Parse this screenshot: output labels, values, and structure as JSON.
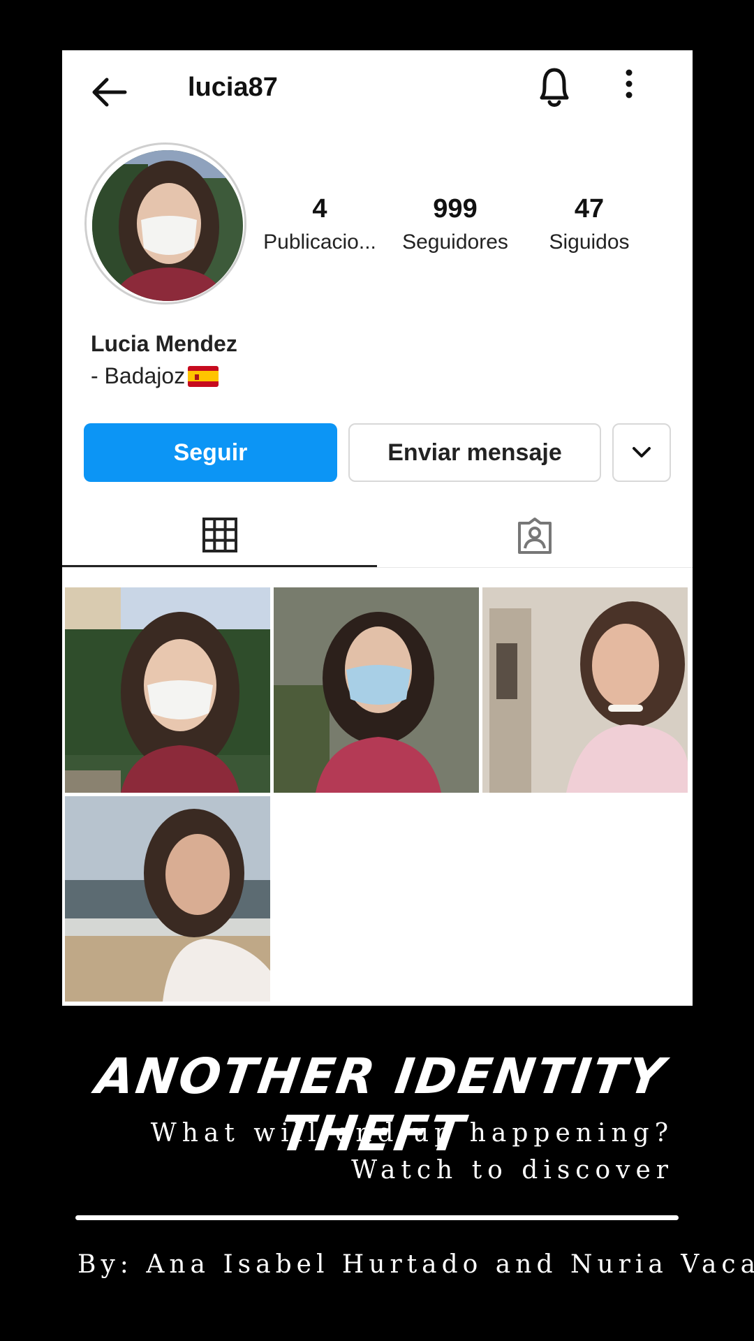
{
  "profile": {
    "username": "lucia87",
    "full_name": "Lucia Mendez",
    "bio": "- Badajoz",
    "flag_icon": "spain-flag-emoji"
  },
  "stats": [
    {
      "value": "4",
      "label": "Publicacio..."
    },
    {
      "value": "999",
      "label": "Seguidores"
    },
    {
      "value": "47",
      "label": "Siguidos"
    }
  ],
  "actions": {
    "follow": "Seguir",
    "message": "Enviar mensaje"
  },
  "colors": {
    "follow_button": "#0c95f5",
    "background": "#000000"
  },
  "poster": {
    "title": "ANOTHER IDENTITY THEFT",
    "tagline_line1": "What will end up happening?",
    "tagline_line2": "Watch to discover",
    "credits": "By: Ana Isabel Hurtado and Nuria Vaca"
  }
}
